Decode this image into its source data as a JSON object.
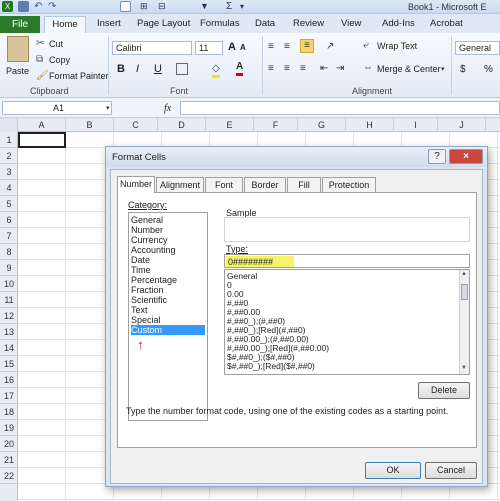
{
  "window": {
    "title": "Book1 - Microsoft E"
  },
  "ribbon_tabs": [
    "File",
    "Home",
    "Insert",
    "Page Layout",
    "Formulas",
    "Data",
    "Review",
    "View",
    "Add-Ins",
    "Acrobat"
  ],
  "clipboard": {
    "paste": "Paste",
    "cut": "Cut",
    "copy": "Copy",
    "format_painter": "Format Painter",
    "label": "Clipboard"
  },
  "font": {
    "name": "Calibri",
    "size": "11",
    "grow": "A",
    "shrink": "A",
    "bold": "B",
    "italic": "I",
    "underline": "U",
    "label": "Font"
  },
  "alignment": {
    "wrap_text": "Wrap Text",
    "merge": "Merge & Center",
    "label": "Alignment"
  },
  "number": {
    "format": "General",
    "currency": "$",
    "percent": "%"
  },
  "formula_bar": {
    "name_box": "A1",
    "fx": "fx",
    "value": ""
  },
  "columns": [
    "A",
    "B",
    "C",
    "D",
    "E",
    "F",
    "G",
    "H",
    "I",
    "J"
  ],
  "rows": [
    "1",
    "2",
    "3",
    "4",
    "5",
    "6",
    "7",
    "8",
    "9",
    "10",
    "11",
    "12",
    "13",
    "14",
    "15",
    "16",
    "17",
    "18",
    "19",
    "20",
    "21",
    "22"
  ],
  "dialog": {
    "title": "Format Cells",
    "help": "?",
    "close": "×",
    "tabs": [
      "Number",
      "Alignment",
      "Font",
      "Border",
      "Fill",
      "Protection"
    ],
    "category_label": "Category:",
    "categories": [
      "General",
      "Number",
      "Currency",
      "Accounting",
      "Date",
      "Time",
      "Percentage",
      "Fraction",
      "Scientific",
      "Text",
      "Special",
      "Custom"
    ],
    "selected_category": "Custom",
    "sample_label": "Sample",
    "sample_value": "",
    "type_label": "Type:",
    "type_value": "0########",
    "formats": [
      "General",
      "0",
      "0.00",
      "#,##0",
      "#,##0.00",
      "#,##0_);(#,##0)",
      "#,##0_);[Red](#,##0)",
      "#,##0.00_);(#,##0.00)",
      "#,##0.00_);[Red](#,##0.00)",
      "$#,##0_);($#,##0)",
      "$#,##0_);[Red]($#,##0)"
    ],
    "delete": "Delete",
    "description": "Type the number format code, using one of the existing codes as a starting point.",
    "ok": "OK",
    "cancel": "Cancel",
    "annotation_arrow": "↑"
  },
  "colors": {
    "file_tab": "#2a7a2a",
    "selection": "#3399ff",
    "highlight": "#f4f36a",
    "annotation": "#e01010"
  }
}
